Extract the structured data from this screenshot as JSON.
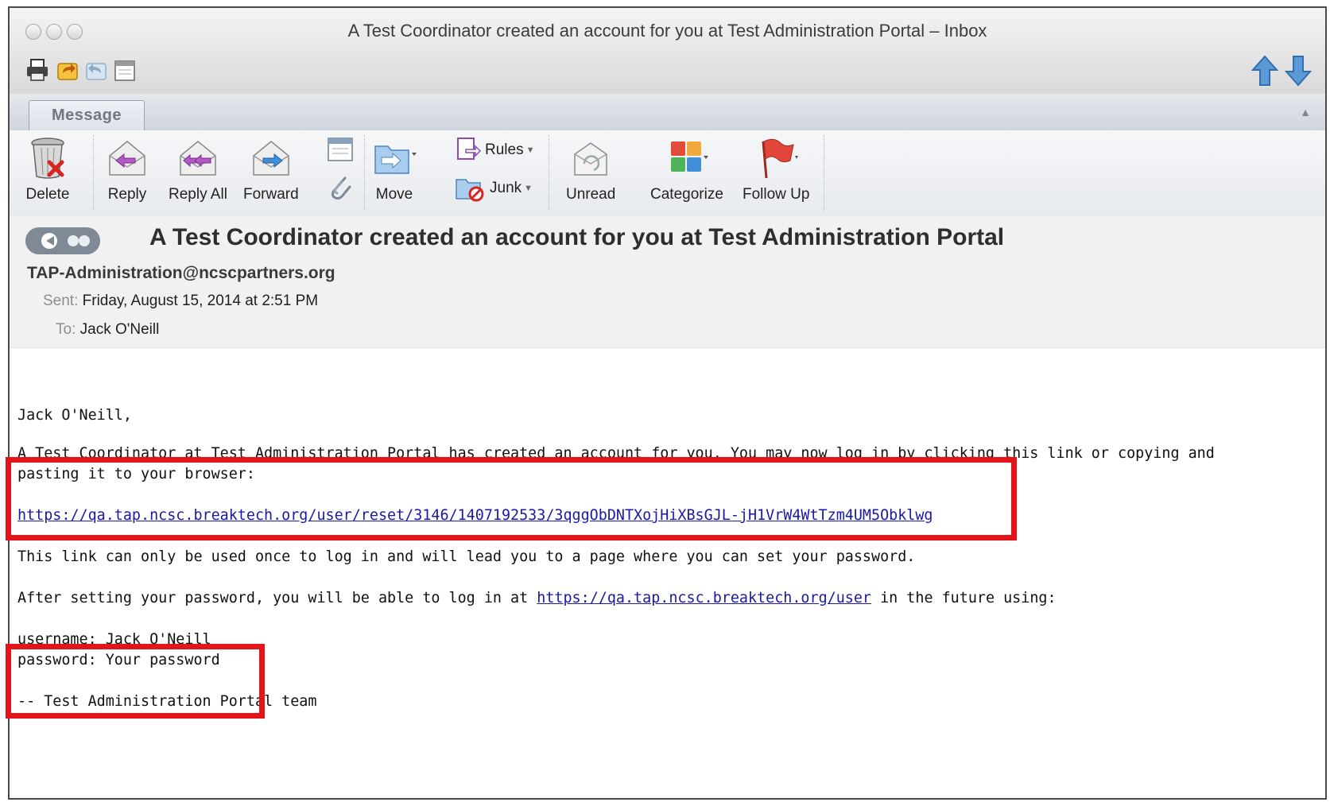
{
  "window": {
    "title": "A Test Coordinator created an account for you at Test Administration Portal – Inbox"
  },
  "tab": {
    "label": "Message"
  },
  "ribbon": {
    "delete": "Delete",
    "reply": "Reply",
    "reply_all": "Reply All",
    "forward": "Forward",
    "move": "Move",
    "rules": "Rules",
    "junk": "Junk",
    "unread": "Unread",
    "categorize": "Categorize",
    "follow_up": "Follow Up"
  },
  "message": {
    "subject": "A Test Coordinator created an account for you at Test Administration Portal",
    "from": "TAP-Administration@ncscpartners.org",
    "sent_label": "Sent:",
    "sent_value": "Friday, August 15, 2014 at 2:51 PM",
    "to_label": "To:",
    "to_value": "Jack O'Neill"
  },
  "body": {
    "greeting": "Jack O'Neill,",
    "line1": "A Test Coordinator at Test Administration Portal has created an account for you. You may now log in by clicking this link or copying and",
    "line2": "pasting it to your browser:",
    "reset_link": "https://qa.tap.ncsc.breaktech.org/user/reset/3146/1407192533/3qggObDNTXojHiXBsGJL-jH1VrW4WtTzm4UM5Obklwg",
    "line3": "This link can only be used once to log in and will lead you to a page where you can set your password.",
    "line4_prefix": "After setting your password, you will be able to log in at",
    "user_link": "https://qa.tap.ncsc.breaktech.org/user",
    "line4_suffix": "in the future using:",
    "username_line": "username: Jack O'Neill",
    "password_line": "password: Your password",
    "signature": "--  Test Administration Portal team"
  },
  "colors": {
    "highlight_box": "#e3151a",
    "link": "#1a1aa6"
  }
}
